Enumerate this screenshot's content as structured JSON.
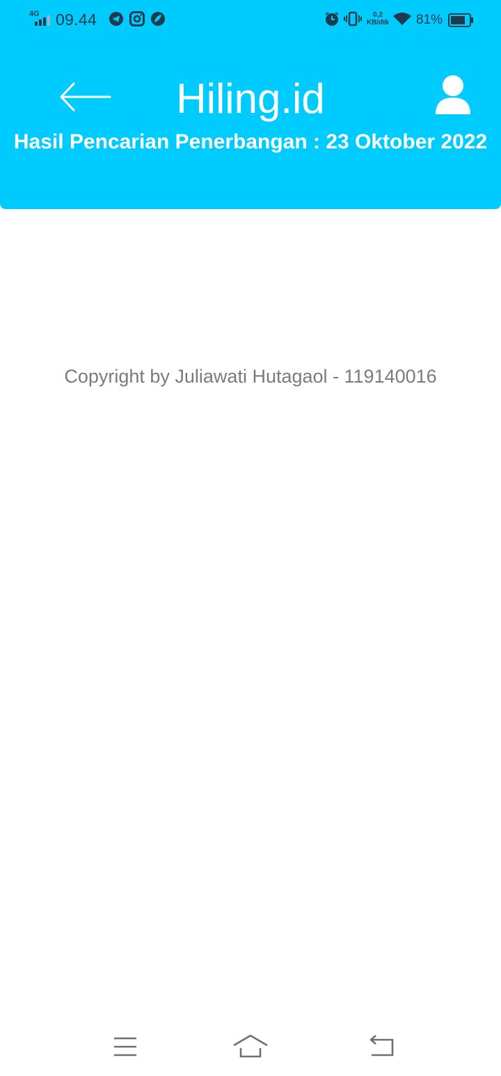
{
  "status_bar": {
    "network_type": "4G",
    "time": "09.44",
    "net_speed_value": "0,2",
    "net_speed_unit": "KB/dtk",
    "battery_percent": "81%",
    "battery_level": 0.81,
    "icons": [
      "signal-icon",
      "telegram-icon",
      "instagram-icon",
      "app-icon",
      "alarm-icon",
      "vibrate-icon",
      "wifi-icon",
      "battery-icon"
    ]
  },
  "header": {
    "title": "Hiling.id",
    "subtitle": "Hasil Pencarian Penerbangan : 23 Oktober 2022",
    "background": "#00cbff",
    "back_icon": "arrow-left-icon",
    "profile_icon": "user-icon"
  },
  "footer": {
    "copyright": "Copyright by Juliawati Hutagaol - 119140016"
  },
  "nav_bar": {
    "icons": [
      "menu-icon",
      "home-icon",
      "back-icon"
    ]
  }
}
